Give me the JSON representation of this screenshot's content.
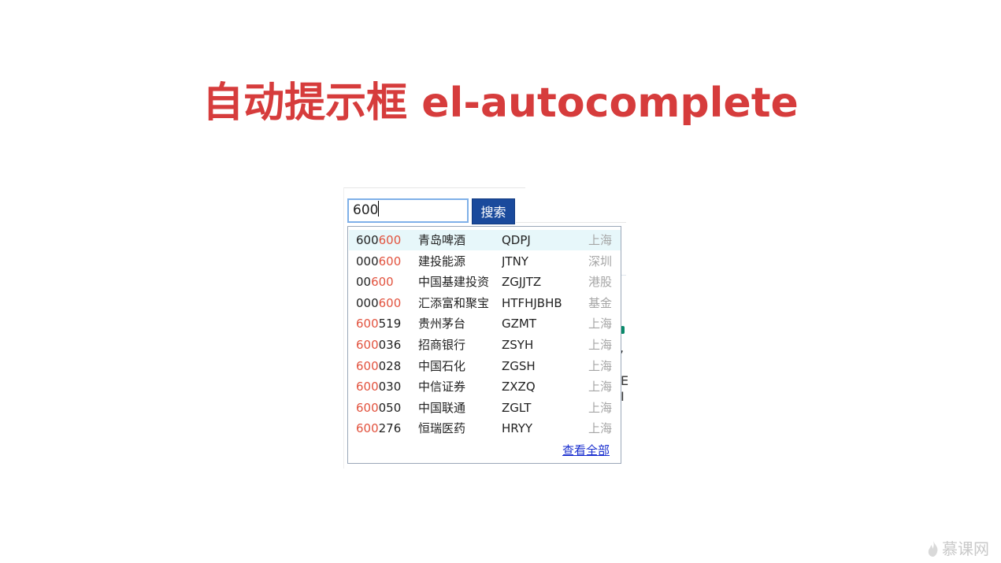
{
  "slide": {
    "title": "自动提示框 el-autocomplete"
  },
  "search": {
    "value": "600",
    "button_label": "搜索"
  },
  "suggestions": [
    {
      "code_pre": "600",
      "code_match": "600",
      "code_post": "",
      "name": "青岛啤酒",
      "abbr": "QDPJ",
      "market": "上海",
      "active": true
    },
    {
      "code_pre": "000",
      "code_match": "600",
      "code_post": "",
      "name": "建投能源",
      "abbr": "JTNY",
      "market": "深圳",
      "active": false
    },
    {
      "code_pre": "00",
      "code_match": "600",
      "code_post": "",
      "name": "中国基建投资",
      "abbr": "ZGJJTZ",
      "market": "港股",
      "active": false
    },
    {
      "code_pre": "000",
      "code_match": "600",
      "code_post": "",
      "name": "汇添富和聚宝",
      "abbr": "HTFHJBHB",
      "market": "基金",
      "active": false
    },
    {
      "code_pre": "",
      "code_match": "600",
      "code_post": "519",
      "name": "贵州茅台",
      "abbr": "GZMT",
      "market": "上海",
      "active": false
    },
    {
      "code_pre": "",
      "code_match": "600",
      "code_post": "036",
      "name": "招商银行",
      "abbr": "ZSYH",
      "market": "上海",
      "active": false
    },
    {
      "code_pre": "",
      "code_match": "600",
      "code_post": "028",
      "name": "中国石化",
      "abbr": "ZGSH",
      "market": "上海",
      "active": false
    },
    {
      "code_pre": "",
      "code_match": "600",
      "code_post": "030",
      "name": "中信证券",
      "abbr": "ZXZQ",
      "market": "上海",
      "active": false
    },
    {
      "code_pre": "",
      "code_match": "600",
      "code_post": "050",
      "name": "中国联通",
      "abbr": "ZGLT",
      "market": "上海",
      "active": false
    },
    {
      "code_pre": "",
      "code_match": "600",
      "code_post": "276",
      "name": "恒瑞医药",
      "abbr": "HRYY",
      "market": "上海",
      "active": false
    }
  ],
  "view_all_label": "查看全部",
  "watermark": "慕课网",
  "colors": {
    "title": "#d63c3c",
    "highlight": "#e2533f",
    "button_bg": "#1a4a9c",
    "link": "#1a2fcf",
    "active_row": "#e7f7fa"
  }
}
